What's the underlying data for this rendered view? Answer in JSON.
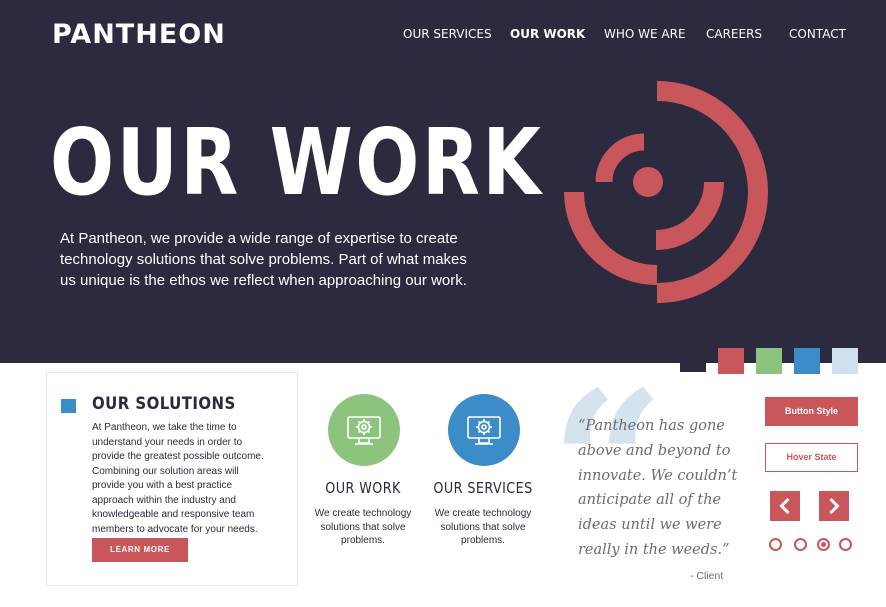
{
  "header": {
    "logo": "PANTHEON",
    "nav": [
      {
        "label": "OUR SERVICES",
        "active": false
      },
      {
        "label": "OUR WORK",
        "active": true
      },
      {
        "label": "WHO WE ARE",
        "active": false
      },
      {
        "label": "CAREERS",
        "active": false
      },
      {
        "label": "CONTACT",
        "active": false
      }
    ]
  },
  "hero": {
    "title": "OUR WORK",
    "description": "At Pantheon, we provide a wide range of expertise to create technology solutions that solve problems. Part of what makes us unique is the ethos we reflect when approaching our work.",
    "graphic_icon": "pantheon-target-icon"
  },
  "colors": {
    "navy": "#2b2a3e",
    "red": "#c9565a",
    "green": "#8cc47e",
    "blue": "#3c8cca",
    "light_blue": "#cfe1ef",
    "quote_gray": "#6d6a76"
  },
  "swatches": [
    "#2b2a3e",
    "#c9565a",
    "#8cc47e",
    "#3c8cca",
    "#cfe1ef"
  ],
  "solutions": {
    "title": "OUR SOLUTIONS",
    "text": "At Pantheon, we take the time to understand your needs in order to provide the greatest possible outcome. Combining our solution areas will provide you with a best practice approach within the industry and knowledgeable and responsive team members to advocate for your needs.",
    "button": "LEARN MORE"
  },
  "features": [
    {
      "title": "OUR WORK",
      "text": "We create technology solutions that solve problems.",
      "color": "#8cc47e",
      "icon": "monitor-gear-icon"
    },
    {
      "title": "OUR SERVICES",
      "text": "We create technology solutions that solve problems.",
      "color": "#3c8cca",
      "icon": "monitor-gear-icon"
    }
  ],
  "testimonial": {
    "quote_mark": "“",
    "quote": "“Pantheon has gone above and beyond to innovate. We couldn’t anticipate all of the ideas until we were really in the weeds.”",
    "cite": "- Client"
  },
  "style_guide": {
    "button_style": "Button Style",
    "hover_state": "Hover State",
    "prev_icon": "chevron-left-icon",
    "next_icon": "chevron-right-icon",
    "dots": [
      false,
      false,
      true,
      false
    ]
  }
}
